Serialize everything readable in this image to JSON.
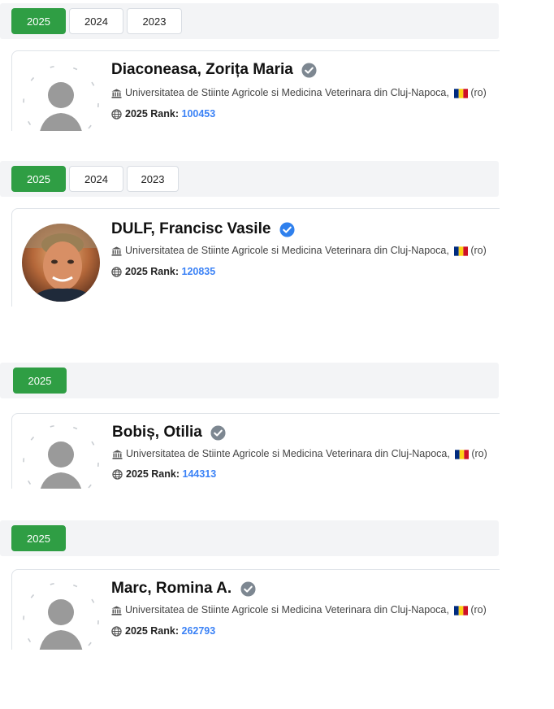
{
  "profiles": [
    {
      "tabs": [
        "2025",
        "2024",
        "2023"
      ],
      "active_tab": "2025",
      "name": "Diaconeasa, Zorița Maria",
      "verified": "gray",
      "avatar": "placeholder",
      "institution": "Universitatea de Stiinte Agricole si Medicina Veterinara din Cluj-Napoca,",
      "country_code": "(ro)",
      "rank_label": "2025 Rank:",
      "rank_value": "100453"
    },
    {
      "tabs": [
        "2025",
        "2024",
        "2023"
      ],
      "active_tab": "2025",
      "name": "DULF, Francisc Vasile",
      "verified": "blue",
      "avatar": "photo",
      "institution": "Universitatea de Stiinte Agricole si Medicina Veterinara din Cluj-Napoca,",
      "country_code": "(ro)",
      "rank_label": "2025 Rank:",
      "rank_value": "120835"
    },
    {
      "tabs": [
        "2025"
      ],
      "active_tab": "2025",
      "name": "Bobiș, Otilia",
      "verified": "gray",
      "avatar": "placeholder",
      "institution": "Universitatea de Stiinte Agricole si Medicina Veterinara din Cluj-Napoca,",
      "country_code": "(ro)",
      "rank_label": "2025 Rank:",
      "rank_value": "144313"
    },
    {
      "tabs": [
        "2025"
      ],
      "active_tab": "2025",
      "name": "Marc, Romina A.",
      "verified": "gray",
      "avatar": "placeholder",
      "institution": "Universitatea de Stiinte Agricole si Medicina Veterinara din Cluj-Napoca,",
      "country_code": "(ro)",
      "rank_label": "2025 Rank:",
      "rank_value": "262793"
    }
  ],
  "colors": {
    "active_tab": "#2f9e44",
    "rank_value": "#3b82f6",
    "verified_gray": "#7d8791",
    "verified_blue": "#2f80ed",
    "flag": [
      "#002b7f",
      "#fcd116",
      "#ce1126"
    ]
  }
}
